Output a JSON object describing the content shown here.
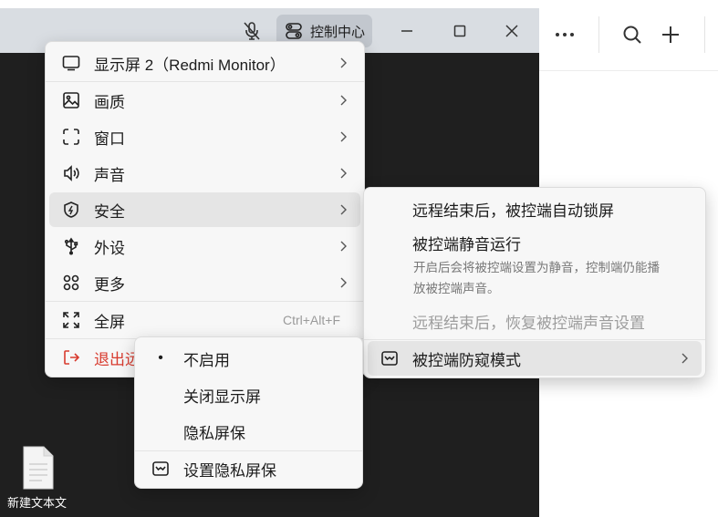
{
  "titlebar": {
    "control_center_label": "控制中心"
  },
  "desktop": {
    "file_label": "新建文本文"
  },
  "main_menu": {
    "items": [
      {
        "label": "显示屏 2（Redmi Monitor）",
        "icon": "monitor-icon"
      },
      {
        "label": "画质",
        "icon": "image-icon"
      },
      {
        "label": "窗口",
        "icon": "window-frame-icon"
      },
      {
        "label": "声音",
        "icon": "speaker-icon"
      },
      {
        "label": "安全",
        "icon": "shield-icon"
      },
      {
        "label": "外设",
        "icon": "usb-icon"
      },
      {
        "label": "更多",
        "icon": "grid-icon"
      },
      {
        "label": "全屏",
        "icon": "fullscreen-icon",
        "shortcut": "Ctrl+Alt+F"
      },
      {
        "label": "退出远",
        "icon": "exit-icon"
      }
    ]
  },
  "security_menu": {
    "auto_lock": "远程结束后，被控端自动锁屏",
    "mute_title": "被控端静音运行",
    "mute_desc_1": "开启后会将被控端设置为静音，控制端仍能播",
    "mute_desc_2": "放被控端声音。",
    "restore_sound": "远程结束后，恢复被控端声音设置",
    "anti_peek": "被控端防窥模式"
  },
  "anti_peek_menu": {
    "bullet": "•",
    "items": [
      "不启用",
      "关闭显示屏",
      "隐私屏保",
      "设置隐私屏保"
    ]
  },
  "colors": {
    "accent_danger": "#d83b2f",
    "titlebar_bg": "#d9dde2",
    "remote_bg": "#1f1f1f",
    "menu_bg": "#f7f7f7",
    "highlight": "#e5e5e5"
  }
}
